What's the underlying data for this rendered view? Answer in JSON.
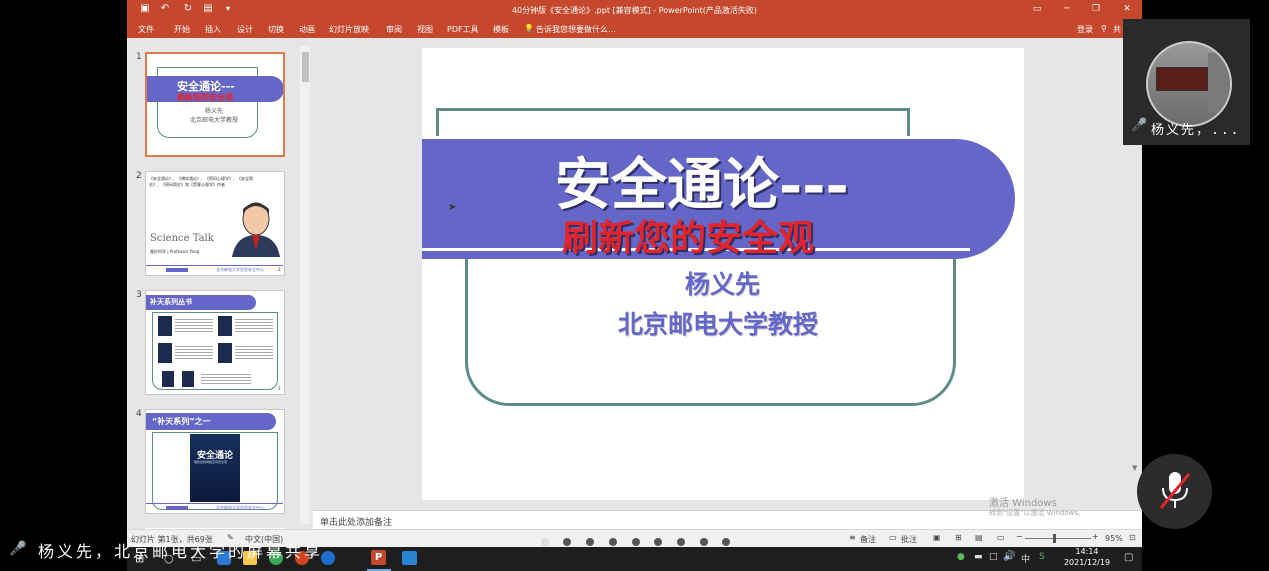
{
  "window": {
    "title": "40分钟版《安全通论》.ppt [兼容模式] - PowerPoint(产品激活失败)",
    "signin": "登录",
    "share": "共"
  },
  "menu": {
    "items": [
      "文件",
      "开始",
      "插入",
      "设计",
      "切换",
      "动画",
      "幻灯片放映",
      "审阅",
      "视图",
      "PDF工具",
      "模板"
    ],
    "tellme": "告诉我您想要做什么..."
  },
  "thumbs": {
    "numbers": [
      "1",
      "2",
      "3",
      "4"
    ],
    "t1": {
      "title": "安全通论---",
      "subtitle": "刷新您的安全观",
      "name": "杨义先",
      "org": "北京邮电大学教授"
    },
    "t2": {
      "header": "《安全通论》、《博弈通论》、《密码心理学》、《安全简史》、《密码简史》和《黑客心理学》作者",
      "brand": "Science Talk",
      "caption": "美妙科学 | Professor Yang",
      "footer": "北京邮电大学信息安全中心",
      "page": "2"
    },
    "t3": {
      "header": "补天系列丛书",
      "page": "3"
    },
    "t4": {
      "header": "“补天系列”之一",
      "book_title": "安全通论",
      "book_sub": "刷新您的网络空间安全观"
    }
  },
  "slide": {
    "title": "安全通论---",
    "subtitle": "刷新您的安全观",
    "author": "杨义先",
    "affiliation": "北京邮电大学教授"
  },
  "notes": {
    "placeholder": "单击此处添加备注"
  },
  "status": {
    "slide_info": "幻灯片 第1张，共69张",
    "lang": "中文(中国)",
    "notes_btn": "备注",
    "comments_btn": "批注",
    "zoom": "95%"
  },
  "taskbar": {
    "time": "14:14",
    "date": "2021/12/19"
  },
  "watermark": {
    "line1": "激活 Windows",
    "line2": "转到\"设置\"以激活 Windows。"
  },
  "meeting": {
    "participant": "杨义先，...",
    "share_text": "杨义先，北京邮电大学的屏幕共享"
  },
  "colors": {
    "ribbon": "#c5472c",
    "banner": "#6466c8",
    "title_red": "#e3252b",
    "box_border": "#5e8c88"
  }
}
